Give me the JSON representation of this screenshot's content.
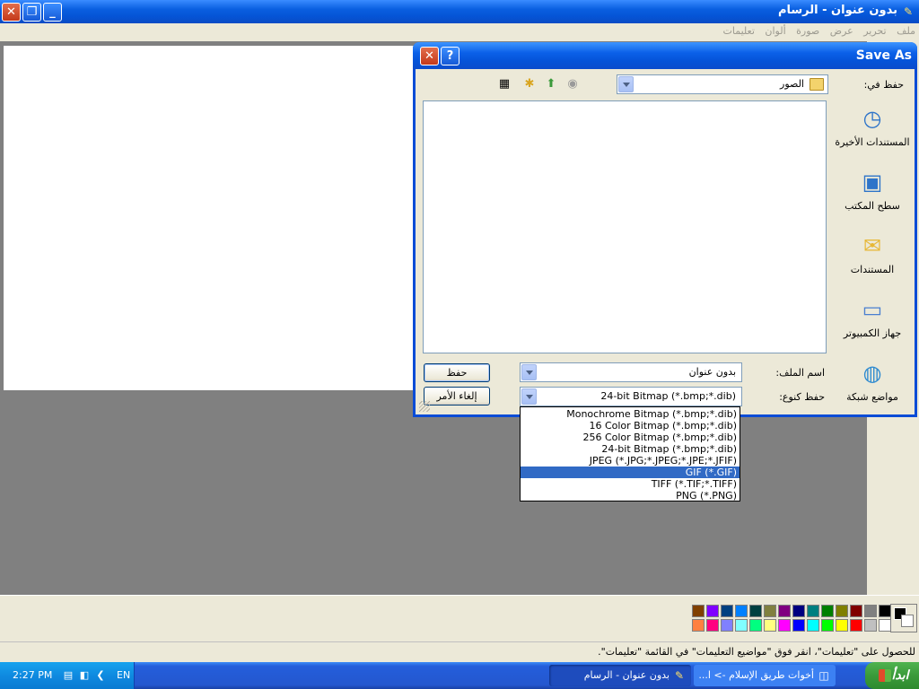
{
  "paint": {
    "title": "بدون عنوان - الرسام",
    "menu": [
      "ملف",
      "تحرير",
      "عرض",
      "صورة",
      "ألوان",
      "تعليمات"
    ],
    "status_text": "للحصول على \"تعليمات\"، انقر فوق \"مواضيع التعليمات\" في القائمة \"تعليمات\".",
    "palette_top": [
      "#000000",
      "#808080",
      "#800000",
      "#808000",
      "#008000",
      "#008080",
      "#000080",
      "#800080",
      "#808040",
      "#004040",
      "#0080ff",
      "#004080",
      "#8000ff",
      "#804000"
    ],
    "palette_bottom": [
      "#ffffff",
      "#c0c0c0",
      "#ff0000",
      "#ffff00",
      "#00ff00",
      "#00ffff",
      "#0000ff",
      "#ff00ff",
      "#ffff80",
      "#00ff80",
      "#80ffff",
      "#8080ff",
      "#ff0080",
      "#ff8040"
    ],
    "foreground_color": "#000000",
    "background_color": "#ffffff"
  },
  "dialog": {
    "title": "Save As",
    "save_in_label": "حفظ في:",
    "save_in_value": "الصور",
    "places": [
      {
        "label": "المستندات الأخيرة",
        "icon": "recent-documents-icon"
      },
      {
        "label": "سطح المكتب",
        "icon": "desktop-icon"
      },
      {
        "label": "المستندات",
        "icon": "my-documents-icon"
      },
      {
        "label": "جهاز الكمبيوتر",
        "icon": "my-computer-icon"
      },
      {
        "label": "مواضع شبكة",
        "icon": "network-places-icon"
      }
    ],
    "filename_label": "اسم الملف:",
    "filename_value": "بدون عنوان",
    "filetype_label": "حفظ كنوع:",
    "filetype_value": "24-bit Bitmap (*.bmp;*.dib)",
    "save_button": "حفظ",
    "cancel_button": "إلغاء الأمر",
    "help_button": "?",
    "close_button": "✕"
  },
  "filetype_options": [
    {
      "label": "Monochrome Bitmap (*.bmp;*.dib)",
      "selected": false
    },
    {
      "label": "16 Color Bitmap (*.bmp;*.dib)",
      "selected": false
    },
    {
      "label": "256 Color Bitmap (*.bmp;*.dib)",
      "selected": false
    },
    {
      "label": "24-bit Bitmap (*.bmp;*.dib)",
      "selected": false
    },
    {
      "label": "JPEG (*.JPG;*.JPEG;*.JPE;*.JFIF)",
      "selected": false
    },
    {
      "label": "GIF (*.GIF)",
      "selected": true
    },
    {
      "label": "TIFF (*.TIF;*.TIFF)",
      "selected": false
    },
    {
      "label": "PNG (*.PNG)",
      "selected": false
    }
  ],
  "taskbar": {
    "start_label": "ابدأ",
    "tasks": [
      {
        "label": "أخوات طريق الإسلام -> ا...",
        "active": false
      },
      {
        "label": "بدون عنوان - الرسام",
        "active": true
      }
    ],
    "language": "EN",
    "clock": "2:27 PM"
  }
}
